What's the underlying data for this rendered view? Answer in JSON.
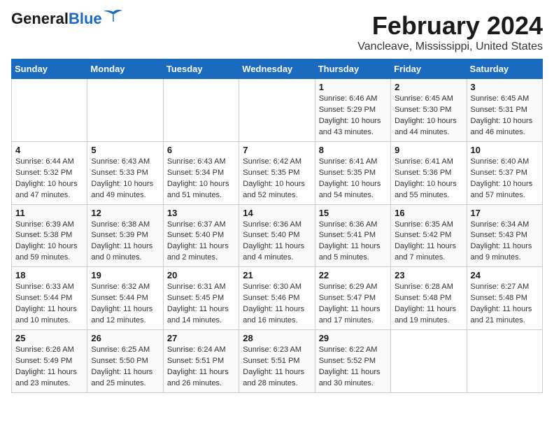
{
  "header": {
    "logo_general": "General",
    "logo_blue": "Blue",
    "month": "February 2024",
    "location": "Vancleave, Mississippi, United States"
  },
  "calendar": {
    "days_of_week": [
      "Sunday",
      "Monday",
      "Tuesday",
      "Wednesday",
      "Thursday",
      "Friday",
      "Saturday"
    ],
    "weeks": [
      [
        {
          "day": "",
          "info": ""
        },
        {
          "day": "",
          "info": ""
        },
        {
          "day": "",
          "info": ""
        },
        {
          "day": "",
          "info": ""
        },
        {
          "day": "1",
          "info": "Sunrise: 6:46 AM\nSunset: 5:29 PM\nDaylight: 10 hours\nand 43 minutes."
        },
        {
          "day": "2",
          "info": "Sunrise: 6:45 AM\nSunset: 5:30 PM\nDaylight: 10 hours\nand 44 minutes."
        },
        {
          "day": "3",
          "info": "Sunrise: 6:45 AM\nSunset: 5:31 PM\nDaylight: 10 hours\nand 46 minutes."
        }
      ],
      [
        {
          "day": "4",
          "info": "Sunrise: 6:44 AM\nSunset: 5:32 PM\nDaylight: 10 hours\nand 47 minutes."
        },
        {
          "day": "5",
          "info": "Sunrise: 6:43 AM\nSunset: 5:33 PM\nDaylight: 10 hours\nand 49 minutes."
        },
        {
          "day": "6",
          "info": "Sunrise: 6:43 AM\nSunset: 5:34 PM\nDaylight: 10 hours\nand 51 minutes."
        },
        {
          "day": "7",
          "info": "Sunrise: 6:42 AM\nSunset: 5:35 PM\nDaylight: 10 hours\nand 52 minutes."
        },
        {
          "day": "8",
          "info": "Sunrise: 6:41 AM\nSunset: 5:35 PM\nDaylight: 10 hours\nand 54 minutes."
        },
        {
          "day": "9",
          "info": "Sunrise: 6:41 AM\nSunset: 5:36 PM\nDaylight: 10 hours\nand 55 minutes."
        },
        {
          "day": "10",
          "info": "Sunrise: 6:40 AM\nSunset: 5:37 PM\nDaylight: 10 hours\nand 57 minutes."
        }
      ],
      [
        {
          "day": "11",
          "info": "Sunrise: 6:39 AM\nSunset: 5:38 PM\nDaylight: 10 hours\nand 59 minutes."
        },
        {
          "day": "12",
          "info": "Sunrise: 6:38 AM\nSunset: 5:39 PM\nDaylight: 11 hours\nand 0 minutes."
        },
        {
          "day": "13",
          "info": "Sunrise: 6:37 AM\nSunset: 5:40 PM\nDaylight: 11 hours\nand 2 minutes."
        },
        {
          "day": "14",
          "info": "Sunrise: 6:36 AM\nSunset: 5:40 PM\nDaylight: 11 hours\nand 4 minutes."
        },
        {
          "day": "15",
          "info": "Sunrise: 6:36 AM\nSunset: 5:41 PM\nDaylight: 11 hours\nand 5 minutes."
        },
        {
          "day": "16",
          "info": "Sunrise: 6:35 AM\nSunset: 5:42 PM\nDaylight: 11 hours\nand 7 minutes."
        },
        {
          "day": "17",
          "info": "Sunrise: 6:34 AM\nSunset: 5:43 PM\nDaylight: 11 hours\nand 9 minutes."
        }
      ],
      [
        {
          "day": "18",
          "info": "Sunrise: 6:33 AM\nSunset: 5:44 PM\nDaylight: 11 hours\nand 10 minutes."
        },
        {
          "day": "19",
          "info": "Sunrise: 6:32 AM\nSunset: 5:44 PM\nDaylight: 11 hours\nand 12 minutes."
        },
        {
          "day": "20",
          "info": "Sunrise: 6:31 AM\nSunset: 5:45 PM\nDaylight: 11 hours\nand 14 minutes."
        },
        {
          "day": "21",
          "info": "Sunrise: 6:30 AM\nSunset: 5:46 PM\nDaylight: 11 hours\nand 16 minutes."
        },
        {
          "day": "22",
          "info": "Sunrise: 6:29 AM\nSunset: 5:47 PM\nDaylight: 11 hours\nand 17 minutes."
        },
        {
          "day": "23",
          "info": "Sunrise: 6:28 AM\nSunset: 5:48 PM\nDaylight: 11 hours\nand 19 minutes."
        },
        {
          "day": "24",
          "info": "Sunrise: 6:27 AM\nSunset: 5:48 PM\nDaylight: 11 hours\nand 21 minutes."
        }
      ],
      [
        {
          "day": "25",
          "info": "Sunrise: 6:26 AM\nSunset: 5:49 PM\nDaylight: 11 hours\nand 23 minutes."
        },
        {
          "day": "26",
          "info": "Sunrise: 6:25 AM\nSunset: 5:50 PM\nDaylight: 11 hours\nand 25 minutes."
        },
        {
          "day": "27",
          "info": "Sunrise: 6:24 AM\nSunset: 5:51 PM\nDaylight: 11 hours\nand 26 minutes."
        },
        {
          "day": "28",
          "info": "Sunrise: 6:23 AM\nSunset: 5:51 PM\nDaylight: 11 hours\nand 28 minutes."
        },
        {
          "day": "29",
          "info": "Sunrise: 6:22 AM\nSunset: 5:52 PM\nDaylight: 11 hours\nand 30 minutes."
        },
        {
          "day": "",
          "info": ""
        },
        {
          "day": "",
          "info": ""
        }
      ]
    ]
  }
}
